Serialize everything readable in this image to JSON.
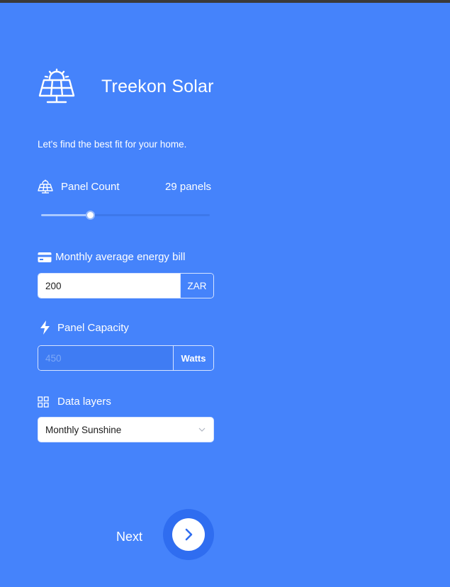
{
  "header": {
    "brand": "Treekon Solar",
    "logo_icon": "solar-panel-icon",
    "tagline": "Let's find the best fit for your home."
  },
  "panel_count": {
    "label": "Panel Count",
    "icon": "solar-panel-icon",
    "value_text": "29 panels",
    "slider_fraction": 0.29
  },
  "energy_bill": {
    "label": "Monthly average energy bill",
    "icon": "credit-card-icon",
    "value": "200",
    "unit": "ZAR"
  },
  "panel_capacity": {
    "label": "Panel Capacity",
    "icon": "lightning-icon",
    "placeholder": "450",
    "unit": "Watts"
  },
  "data_layers": {
    "label": "Data layers",
    "icon": "grid-icon",
    "selected": "Monthly Sunshine"
  },
  "footer": {
    "next_label": "Next",
    "next_icon": "chevron-right-icon"
  },
  "colors": {
    "background": "#4583fb",
    "button": "#2f6df0",
    "slider_fill": "#a9c8ff"
  }
}
